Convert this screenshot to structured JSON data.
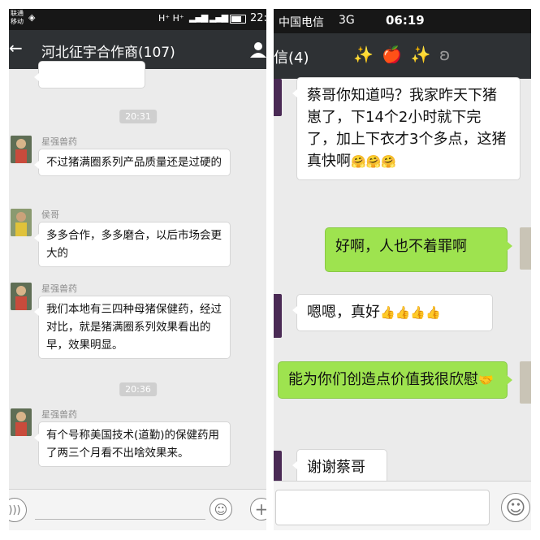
{
  "left": {
    "status": {
      "carrier_line1": "联通",
      "carrier_line2": "移动",
      "network": "H⁺ H⁺",
      "time": "22:"
    },
    "title": "河北征宇合作商(107)",
    "messages": [
      {
        "time": "20:31"
      },
      {
        "sender": "星强兽药",
        "text": "不过猪满圈系列产品质量还是过硬的"
      },
      {
        "sender": "侯哥",
        "text": "多多合作，多多磨合，以后市场会更大的"
      },
      {
        "sender": "星强兽药",
        "text": "我们本地有三四种母猪保健药，经过对比，就是猪满圈系列效果看出的早，效果明显。"
      },
      {
        "time": "20:36"
      },
      {
        "sender": "星强兽药",
        "text": "有个号称美国技术(道勤)的保健药用了两三个月看不出啥效果来。"
      }
    ]
  },
  "right": {
    "status": {
      "carrier": "中国电信",
      "network": "3G",
      "time": "06:19"
    },
    "title": "信(4)",
    "title_emoji": "✨ 🍎 ✨",
    "messages": [
      {
        "dir": "in",
        "text": "蔡哥你知道吗？我家昨天下猪崽了，下14个2小时就下完了，加上下衣才3个多点，这猪真快啊",
        "emoji": "🤗🤗🤗"
      },
      {
        "dir": "out",
        "text": "好啊，人也不着罪啊"
      },
      {
        "dir": "in",
        "text": "嗯嗯，真好",
        "emoji": "👍👍👍👍"
      },
      {
        "dir": "out",
        "text": "能为你们创造点价值我很欣慰",
        "emoji": "🤝"
      },
      {
        "dir": "in",
        "text": "谢谢蔡哥"
      }
    ]
  },
  "colors": {
    "incoming_bubble": "#ffffff",
    "outgoing_bubble": "#9ee34f",
    "chat_background": "#ebebeb",
    "title_bar": "#2e3134",
    "status_bar": "#171717"
  }
}
